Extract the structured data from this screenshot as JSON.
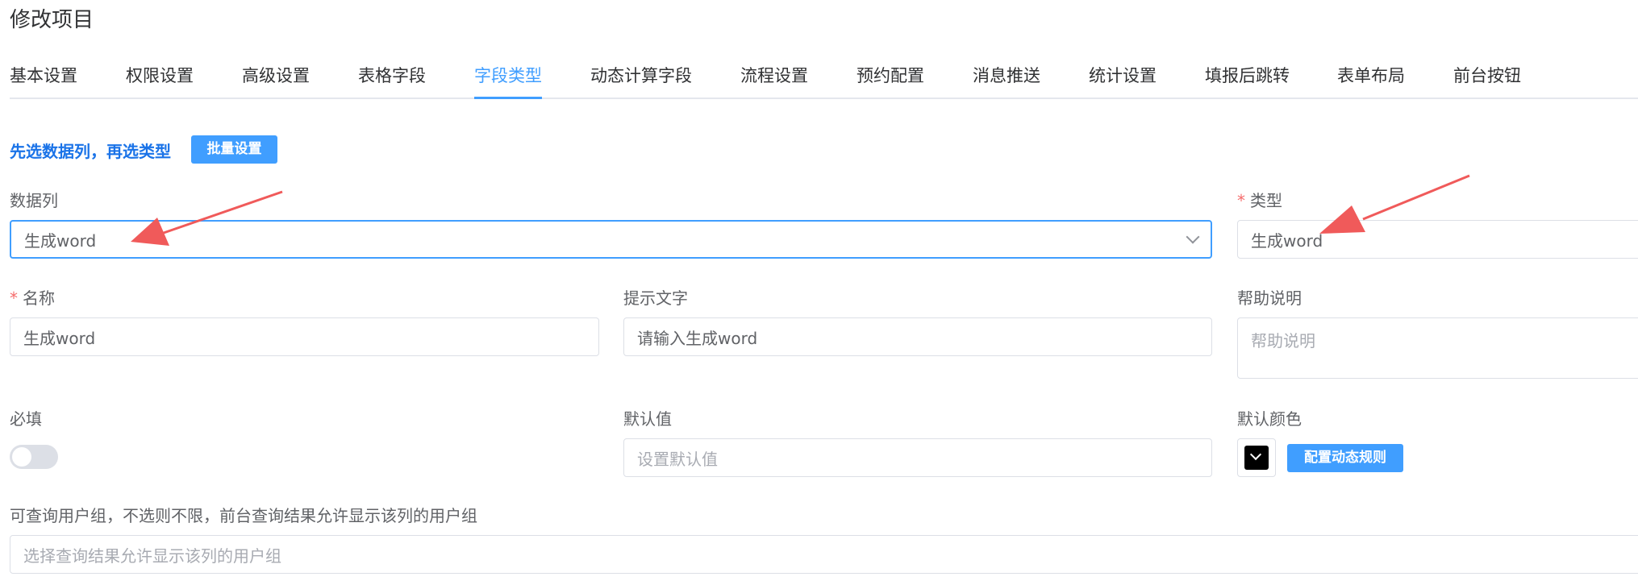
{
  "page": {
    "title": "修改项目"
  },
  "tabs": [
    {
      "label": "基本设置"
    },
    {
      "label": "权限设置"
    },
    {
      "label": "高级设置"
    },
    {
      "label": "表格字段"
    },
    {
      "label": "字段类型"
    },
    {
      "label": "动态计算字段"
    },
    {
      "label": "流程设置"
    },
    {
      "label": "预约配置"
    },
    {
      "label": "消息推送"
    },
    {
      "label": "统计设置"
    },
    {
      "label": "填报后跳转"
    },
    {
      "label": "表单布局"
    },
    {
      "label": "前台按钮"
    }
  ],
  "active_tab": "字段类型",
  "hint": {
    "text": "先选数据列，再选类型",
    "batch_button": "批量设置"
  },
  "form": {
    "data_column": {
      "label": "数据列",
      "value": "生成word"
    },
    "type": {
      "label": "类型",
      "value": "生成word",
      "required": true
    },
    "name": {
      "label": "名称",
      "value": "生成word",
      "required": true
    },
    "tip_text": {
      "label": "提示文字",
      "value": "请输入生成word"
    },
    "help": {
      "label": "帮助说明",
      "placeholder": "帮助说明"
    },
    "required_switch": {
      "label": "必填",
      "checked": false
    },
    "default_value": {
      "label": "默认值",
      "placeholder": "设置默认值"
    },
    "default_color": {
      "label": "默认颜色",
      "color": "#000000",
      "rule_button": "配置动态规则"
    },
    "query_groups": {
      "label": "可查询用户组，不选则不限，前台查询结果允许显示该列的用户组",
      "placeholder": "选择查询结果允许显示该列的用户组"
    }
  },
  "colors": {
    "accent": "#409eff",
    "required": "#f56c6c",
    "annotation_arrow": "#f05a5a"
  },
  "required_mark": "*"
}
